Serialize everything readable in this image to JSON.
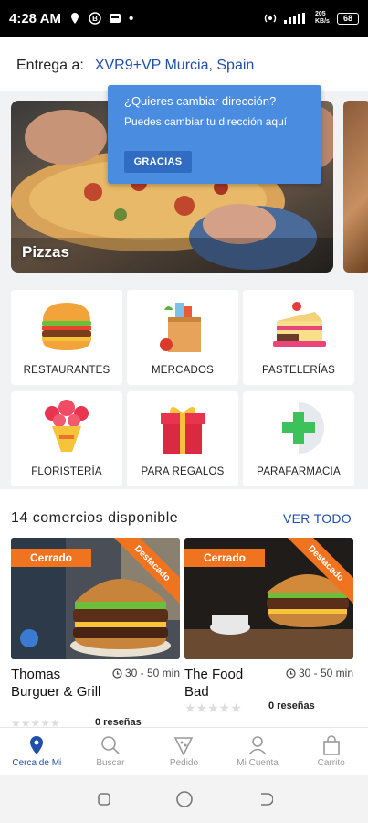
{
  "status": {
    "time": "4:28 AM",
    "net_speed": "205 KB/s",
    "battery": "68"
  },
  "delivery": {
    "label": "Entrega a:",
    "address": "XVR9+VP Murcia, Spain"
  },
  "banner": {
    "label": "Pizzas"
  },
  "tooltip": {
    "title": "¿Quieres cambiar dirección?",
    "body": "Puedes cambiar tu dirección aquí",
    "button": "GRACIAS"
  },
  "categories": [
    {
      "label": "RESTAURANTES",
      "icon": "burger-icon"
    },
    {
      "label": "MERCADOS",
      "icon": "grocery-bag-icon"
    },
    {
      "label": "PASTELERÍAS",
      "icon": "cake-icon"
    },
    {
      "label": "FLORISTERÍA",
      "icon": "flowers-icon"
    },
    {
      "label": "PARA REGALOS",
      "icon": "gift-icon"
    },
    {
      "label": "PARAFARMACIA",
      "icon": "pharmacy-cross-icon"
    }
  ],
  "merchants": {
    "count_label": "14 comercios disponible",
    "see_all": "VER TODO",
    "items": [
      {
        "name": "Thomas Burguer & Grill",
        "time": "30 - 50 min",
        "status": "Cerrado",
        "badge": "Destacado",
        "reviews": "0 reseñas"
      },
      {
        "name": "The Food Bad",
        "time": "30 - 50 min",
        "status": "Cerrado",
        "badge": "Destacado",
        "reviews": "0 reseñas"
      }
    ]
  },
  "nav": [
    {
      "label": "Cerca de Mi",
      "icon": "location-pin-icon",
      "active": true
    },
    {
      "label": "Buscar",
      "icon": "search-icon",
      "active": false
    },
    {
      "label": "Pedido",
      "icon": "pizza-slice-icon",
      "active": false
    },
    {
      "label": "Mi Cuenta",
      "icon": "user-icon",
      "active": false
    },
    {
      "label": "Carrito",
      "icon": "shopping-bag-icon",
      "active": false
    }
  ],
  "colors": {
    "accent": "#1f4fa8",
    "tooltip": "#4a8de0",
    "orange": "#f07420"
  }
}
